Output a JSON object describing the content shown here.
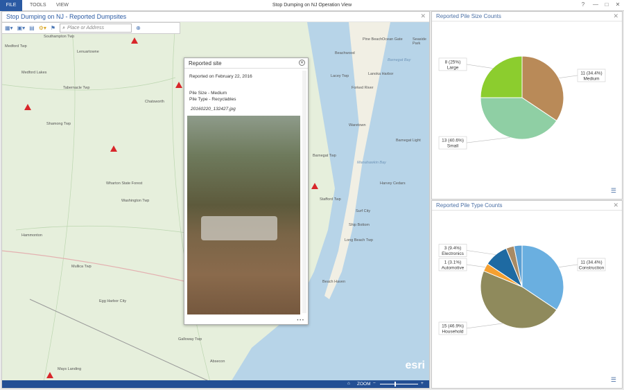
{
  "menubar": {
    "file": "FILE",
    "tools": "TOOLS",
    "view": "VIEW",
    "app_title": "Stop Dumping on NJ Operation View",
    "help": "?",
    "minimize": "—",
    "maximize": "□",
    "close": "✕"
  },
  "map_panel": {
    "title": "Stop Dumping on NJ - Reported Dumpsites",
    "search_placeholder": "Place or Address",
    "zoom_label": "ZOOM",
    "zoom_minus": "−",
    "zoom_plus": "+",
    "logo": "esri",
    "labels": [
      "Medford Twp",
      "Medford Lakes",
      "Southampton Twp",
      "Lenuartowne",
      "Tabernacle Twp",
      "Shamong Twp",
      "Wharton State Forest",
      "Washington Twp",
      "Hammonton",
      "Mullica Twp",
      "Egg Harbor City",
      "Galloway Twp",
      "Mays Landing",
      "Chatsworth",
      "Stafford Twp",
      "Barnegat Twp",
      "Beach Haven",
      "Long Beach Twp",
      "Ship Bottom",
      "Surf City",
      "Harvey Cedars",
      "Barnegat Light",
      "Forked River",
      "Lacey Twp",
      "Waretown",
      "Absecon",
      "Pine Beach",
      "Ocean Gate",
      "Seaside Park",
      "Beachwood",
      "Lanoka Harbor",
      "Barnegat Bay",
      "Manahawkin Bay"
    ]
  },
  "popup": {
    "title": "Reported site",
    "reported": "Reported on February 22, 2016",
    "pile_size": "Pile Size - Medium",
    "pile_type": "Pile Type - Recyclables",
    "filename": "20160220_132427.jpg",
    "more": "• • •"
  },
  "chart_data": [
    {
      "type": "pie",
      "title": "Reported Pile Size Counts",
      "slices": [
        {
          "label": "Medium",
          "value": 11,
          "text": "11 (34.4%)",
          "color": "#b98a58"
        },
        {
          "label": "Small",
          "value": 13,
          "text": "13 (40.6%)",
          "color": "#8fcfa4"
        },
        {
          "label": "Large",
          "value": 8,
          "text": "8 (25%)",
          "color": "#8ccd2e"
        }
      ]
    },
    {
      "type": "pie",
      "title": "Reported Pile Type Counts",
      "slices": [
        {
          "label": "Construction",
          "value": 11,
          "text": "11 (34.4%)",
          "color": "#6aafe0"
        },
        {
          "label": "Household",
          "value": 15,
          "text": "15 (46.9%)",
          "color": "#8f8a5c"
        },
        {
          "label": "Automotive",
          "value": 1,
          "text": "1 (3.1%)",
          "color": "#f5a030"
        },
        {
          "label": "Electronics",
          "value": 3,
          "text": "3 (9.4%)",
          "color": "#1e6aa2"
        },
        {
          "label": "",
          "value": 1,
          "text": "",
          "color": "#a88a64"
        },
        {
          "label": "",
          "value": 1,
          "text": "",
          "color": "#5b9fd3"
        }
      ]
    }
  ]
}
